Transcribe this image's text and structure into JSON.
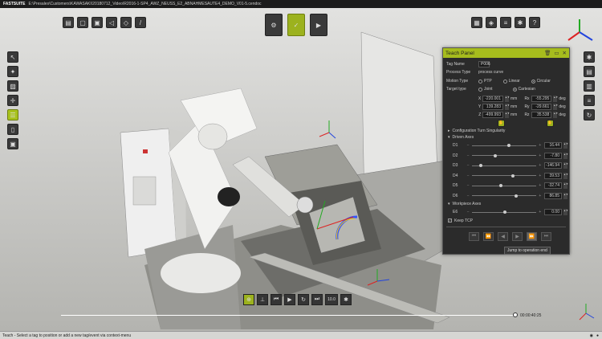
{
  "titlebar": {
    "brand": "FASTSUITE",
    "path": "E:\\Presales\\Customers\\KAWASAKI\\20180712_Video\\R2016-1-SP4_AWZ_NEUSS_E2_ABNAHMESAUTE4_DEMO_V01-5.cendoc"
  },
  "top_toolbar": [
    "open-icon",
    "new-icon",
    "save-icon",
    "undo-icon",
    "redo-icon",
    "measure-icon"
  ],
  "modes": [
    "layout-mode-icon",
    "teach-mode-icon",
    "simulate-mode-icon"
  ],
  "right_toolbar": [
    "view-grid-icon",
    "cube-icon",
    "layers-icon",
    "settings-icon",
    "help-icon"
  ],
  "left_toolbar": [
    "select-icon",
    "snap-icon",
    "frame-icon",
    "position-icon",
    "teach-list-icon",
    "document-icon",
    "panel-icon"
  ],
  "right_side": [
    "gear-icon",
    "sheet-icon",
    "notes-icon",
    "list-icon",
    "cycle-icon"
  ],
  "panel": {
    "title": "Teach Panel",
    "tag_name_label": "Tag Name",
    "tag_name": "P006",
    "process_type_label": "Process Type",
    "process_type": "process curve",
    "motion_type_label": "Motion Type",
    "motion_options": [
      "PTP",
      "Linear",
      "Circular"
    ],
    "motion_selected": "Circular",
    "target_type_label": "Target type",
    "target_options": [
      "Joint",
      "Cartesian"
    ],
    "target_selected": "Cartesian",
    "coords": [
      {
        "ax": "X",
        "val": "-220.001",
        "unit": "mm",
        "rax": "Rx",
        "rval": "-55.295",
        "runit": "deg"
      },
      {
        "ax": "Y",
        "val": "139.283",
        "unit": "mm",
        "rax": "Ry",
        "rval": "-29.661",
        "runit": "deg"
      },
      {
        "ax": "Z",
        "val": "-499.993",
        "unit": "mm",
        "rax": "Rz",
        "rval": "35.538",
        "runit": "deg"
      }
    ],
    "config_label": "Configuration Turn Singularity",
    "driven_label": "Driven Axes",
    "axes": [
      {
        "name": "D1",
        "val": "16.44",
        "pos": 0.56
      },
      {
        "name": "D2",
        "val": "-7.80",
        "pos": 0.36
      },
      {
        "name": "D3",
        "val": "-146.94",
        "pos": 0.14
      },
      {
        "name": "D4",
        "val": "39.53",
        "pos": 0.62
      },
      {
        "name": "D5",
        "val": "-32.74",
        "pos": 0.44
      },
      {
        "name": "D6",
        "val": "86.85",
        "pos": 0.68
      }
    ],
    "workpiece_label": "Workpiece Axes",
    "workpiece": [
      {
        "name": "E6",
        "val": "0.00",
        "pos": 0.5
      }
    ],
    "keep_tcp_label": "Keep TCP",
    "tooltip": "Jump to operation end"
  },
  "bottom_tools": [
    "tag-icon",
    "pin-icon",
    "jump-start-icon",
    "play-icon",
    "loop-icon",
    "jump-end-icon",
    "speed-value",
    "settings-icon"
  ],
  "speed": "10.0",
  "timeline": {
    "time": "00:00:40:25",
    "progress": 0.995
  },
  "status": "Teach - Select a tag to position or add a new tag/event via context-menu"
}
